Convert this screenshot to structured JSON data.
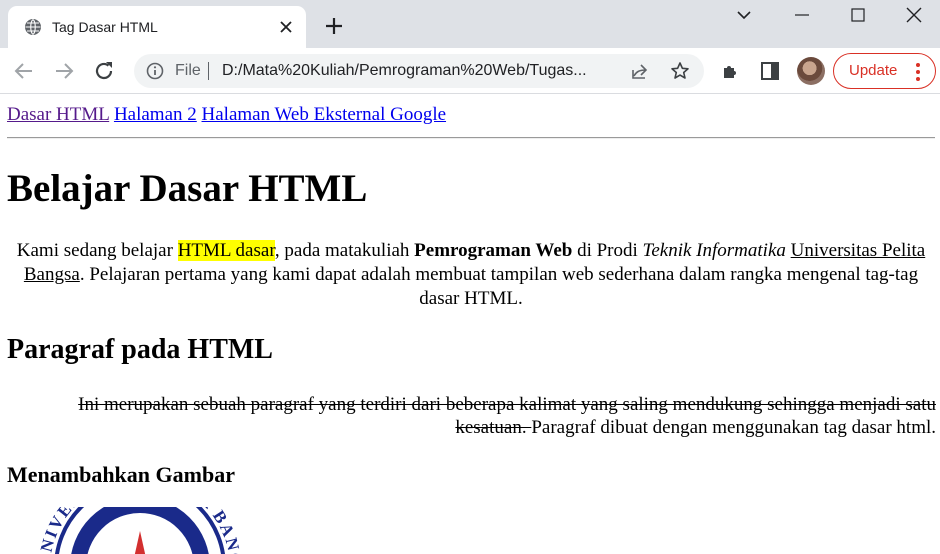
{
  "browser": {
    "tab_title": "Tag Dasar HTML",
    "address_prefix": "File",
    "address_url": "D:/Mata%20Kuliah/Pemrograman%20Web/Tugas...",
    "update_label": "Update"
  },
  "page": {
    "nav_links": [
      "Dasar HTML",
      "Halaman 2",
      "Halaman Web Eksternal Google"
    ],
    "heading": "Belajar Dasar HTML",
    "intro": {
      "part1": "Kami sedang belajar ",
      "highlight": "HTML dasar",
      "part2": ", pada matakuliah ",
      "bold": "Pemrograman Web",
      "part3": " di Prodi ",
      "italic": "Teknik Informatika",
      "part4": " ",
      "underline": "Universitas Pelita Bangsa",
      "part5": ". Pelajaran pertama yang kami dapat adalah membuat tampilan web sederhana dalam rangka mengenal tag-tag dasar HTML."
    },
    "subheading": "Paragraf pada HTML",
    "paragraph": {
      "struck": "Ini merupakan sebuah paragraf yang terdiri dari beberapa kalimat yang saling mendukung sehingga menjadi satu kesatuan. ",
      "normal": "Paragraf dibuat dengan menggunakan tag dasar html."
    },
    "image_heading": "Menambahkan Gambar",
    "logo_text": "UNIVERSITAS PELITA BANGSA"
  },
  "colors": {
    "highlight": "#ffff00",
    "link": "#0000ee",
    "visited_link": "#551a8b",
    "update_accent": "#d93025"
  }
}
